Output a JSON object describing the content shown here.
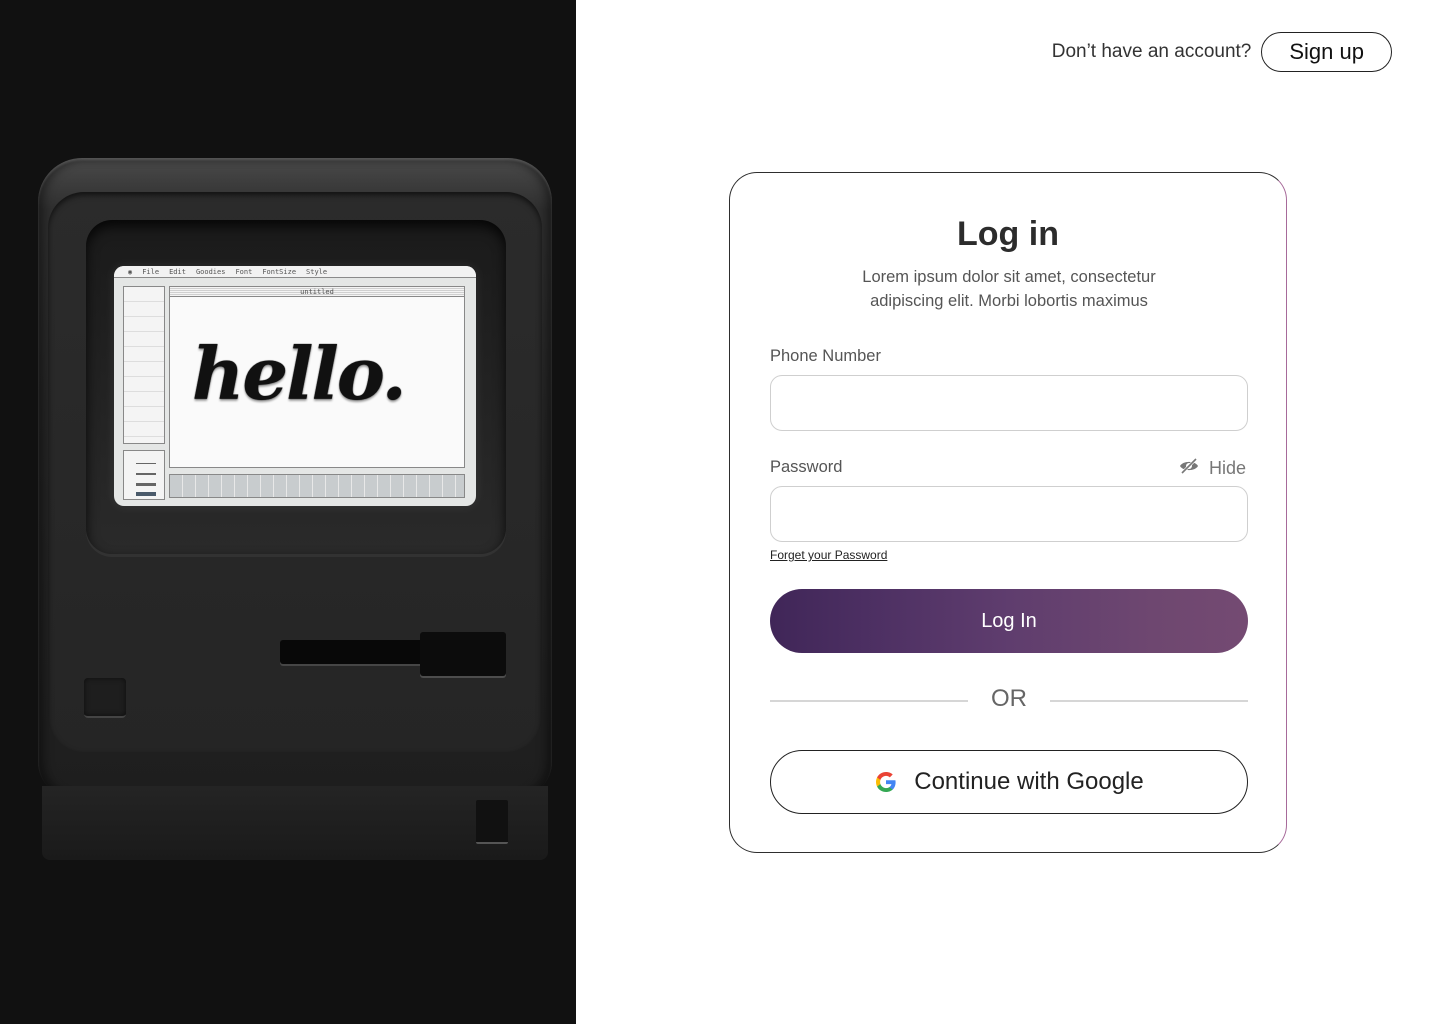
{
  "header": {
    "prompt_text": "Don’t have an account?",
    "signup_label": "Sign up"
  },
  "hero": {
    "screen_text": "hello.",
    "menu_items": [
      "File",
      "Edit",
      "Goodies",
      "Font",
      "FontSize",
      "Style"
    ],
    "canvas_title": "untitled"
  },
  "login": {
    "title": "Log in",
    "subtitle": "Lorem ipsum dolor sit amet, consectetur adipiscing elit. Morbi lobortis maximus",
    "phone_label": "Phone Number",
    "phone_value": "",
    "password_label": "Password",
    "password_value": "",
    "hide_label": "Hide",
    "forgot_label": "Forget your Password",
    "submit_label": "Log In",
    "or_label": "OR",
    "google_label": "Continue with Google"
  },
  "colors": {
    "accent_start": "#402658",
    "accent_end": "#744a72",
    "hero_bg": "#111111"
  },
  "icons": {
    "hide": "eye-off-icon",
    "google": "google-icon"
  }
}
